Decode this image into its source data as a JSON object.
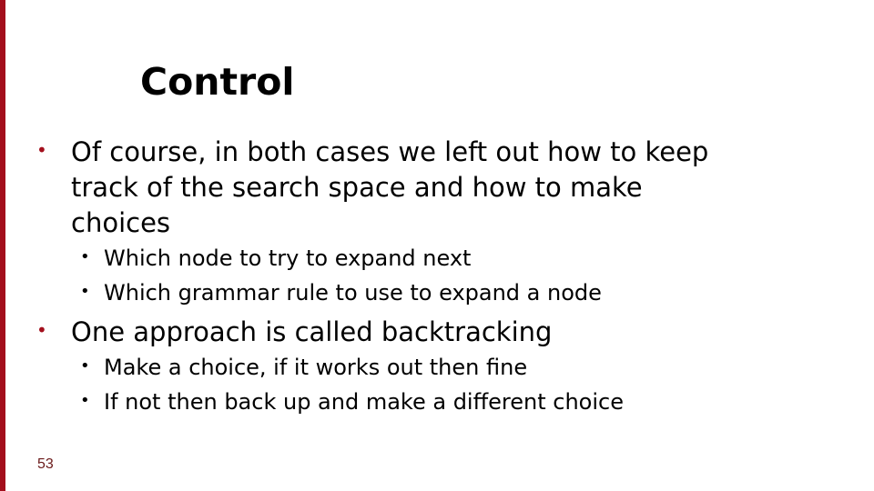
{
  "slide": {
    "accent_color": "#a30f1c",
    "title": "Control",
    "bullets": [
      {
        "text": "Of course, in both cases we left out how to keep track of the search space and how to make choices",
        "sub": [
          "Which node to try to expand next",
          "Which grammar rule to use to expand a node"
        ]
      },
      {
        "text": "One approach is called backtracking",
        "sub": [
          "Make a choice, if it works out then fine",
          "If not then back up and make a different choice"
        ]
      }
    ],
    "page_number": "53"
  }
}
